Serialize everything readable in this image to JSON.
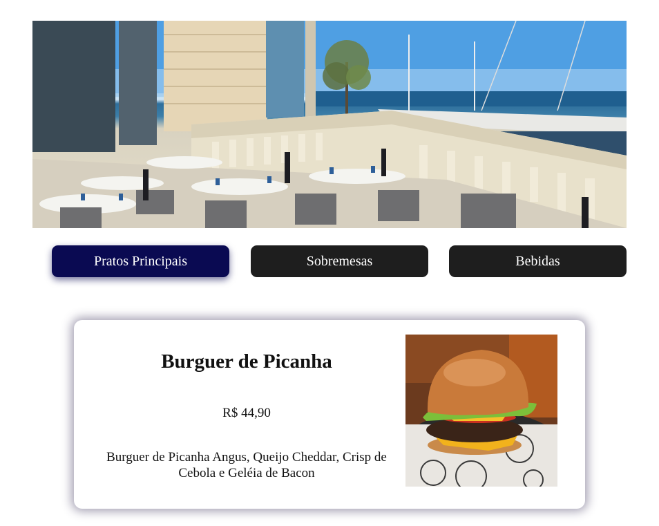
{
  "hero": {
    "image": "restaurant-terrace-marina-photo"
  },
  "tabs": [
    {
      "label": "Pratos Principais",
      "active": true
    },
    {
      "label": "Sobremesas",
      "active": false
    },
    {
      "label": "Bebidas",
      "active": false
    }
  ],
  "menu_item": {
    "name": "Burguer de Picanha",
    "price": "R$ 44,90",
    "description": "Burguer de Picanha Angus, Queijo Cheddar, Crisp de Cebola e Geléia de Bacon",
    "image": "burger-photo"
  },
  "colors": {
    "active_tab": "#0a0a52",
    "inactive_tab": "#1e1e1e"
  }
}
